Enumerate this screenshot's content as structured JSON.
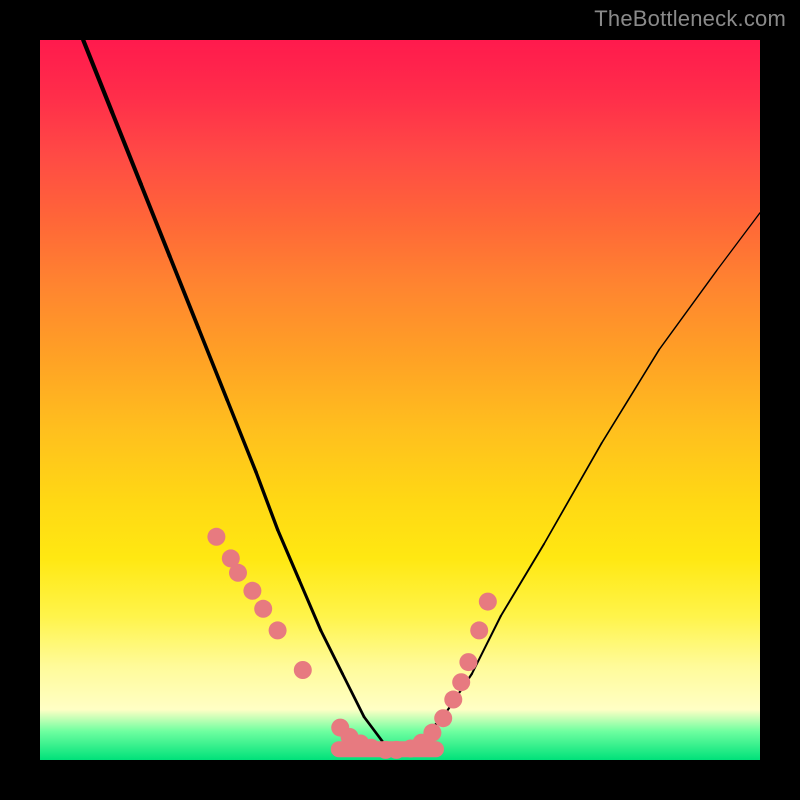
{
  "watermark": "TheBottleneck.com",
  "chart_data": {
    "type": "line",
    "title": "",
    "xlabel": "",
    "ylabel": "",
    "xlim": [
      0,
      100
    ],
    "ylim": [
      0,
      100
    ],
    "series": [
      {
        "name": "curve",
        "x": [
          6,
          10,
          14,
          18,
          22,
          26,
          30,
          33,
          36,
          39,
          42,
          45,
          48,
          52,
          56,
          60,
          64,
          70,
          78,
          86,
          94,
          100
        ],
        "y": [
          100,
          90,
          80,
          70,
          60,
          50,
          40,
          32,
          25,
          18,
          12,
          6,
          2,
          2,
          6,
          12,
          20,
          30,
          44,
          57,
          68,
          76
        ]
      }
    ],
    "markers": {
      "name": "dots",
      "x": [
        24.5,
        26.5,
        27.5,
        29.5,
        31,
        33,
        36.5,
        41.7,
        43,
        44.5,
        46,
        48,
        49.5,
        51.5,
        53,
        54.5,
        56,
        57.4,
        58.5,
        59.5,
        61,
        62.2
      ],
      "y": [
        31,
        28,
        26,
        23.5,
        21,
        18,
        12.5,
        4.5,
        3.2,
        2.3,
        1.7,
        1.4,
        1.4,
        1.6,
        2.4,
        3.8,
        5.8,
        8.4,
        10.8,
        13.6,
        18,
        22
      ],
      "color": "#e77a80",
      "radius": 9
    },
    "flat_band": {
      "x0": 41.5,
      "x1": 55,
      "y": 1.5,
      "color": "#e77a80",
      "thickness": 16
    },
    "curve_stroke": "#000000",
    "curve_width_start": 4.2,
    "curve_width_end": 1.3
  }
}
